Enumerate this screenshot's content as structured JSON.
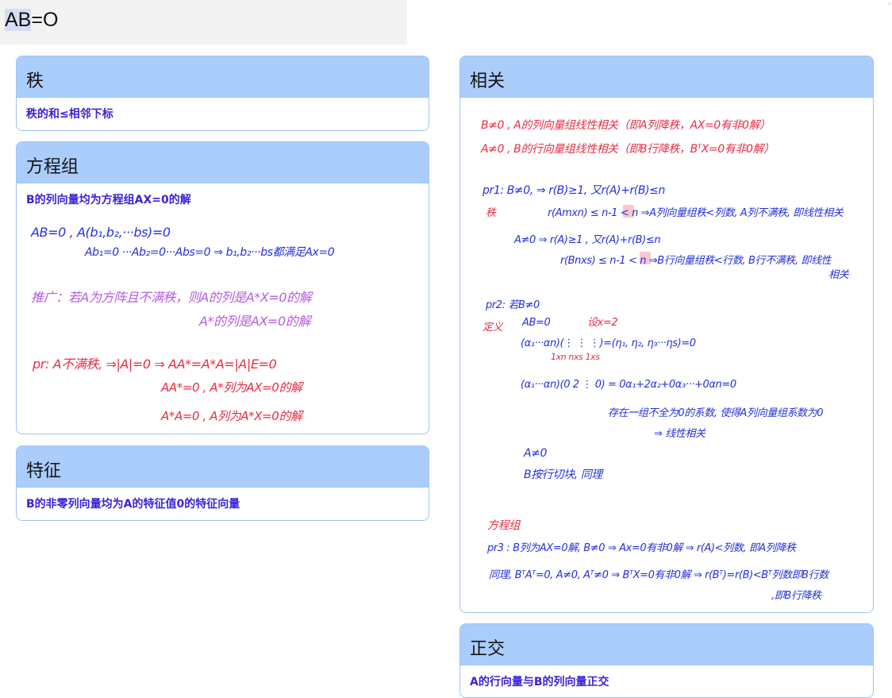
{
  "title": {
    "highlight": "AB",
    "rest": "=O"
  },
  "corner": "◦",
  "cards": {
    "rank": {
      "header": "秩",
      "subtitle": "秩的和≤相邻下标"
    },
    "equations": {
      "header": "方程组",
      "subtitle": "B的列向量均为方程组AX=0的解"
    },
    "eigen": {
      "header": "特征",
      "subtitle": "B的非零列向量均为A的特征值0的特征向量"
    },
    "related": {
      "header": "相关"
    },
    "ortho": {
      "header": "正交",
      "subtitle": "A的行向量与B的列向量正交"
    }
  },
  "notes_equations": {
    "l1": "AB=0 , A(b₁,b₂,···bs)=0",
    "l2": "Ab₁=0 ···Ab₂=0···Abs=0 ⇒ b₁,b₂···bs都满足Ax=0",
    "l3": "推广：若A为方阵且不满秩，则A的列是A*X=0的解",
    "l4": "A*的列是AX=0的解",
    "l5": "pr: A不满秩, ⇒|A|=0 ⇒ AA*=A*A=|A|E=0",
    "l6": "AA*=0 , A*列为AX=0的解",
    "l7": "A*A=0 , A列为A*X=0的解"
  },
  "notes_related": {
    "r1": "B≠0 , A的列向量组线性相关（即A列降秩，AX=0有非0解）",
    "r2": "A≠0 , B的行向量组线性相关（即B行降秩，BᵀX=0有非0解）",
    "r3": "pr1:  B≠0, ⇒ r(B)≥1, 又r(A)+r(B)≤n",
    "r4": "秩",
    "r5": "r(Amxn) ≤ n-1 < n ⇒A列向量组秩<列数, A列不满秩, 即线性相关",
    "r6": "A≠0 ⇒ r(A)≥1 , 又r(A)+r(B)≤n",
    "r7": "r(Bnxs) ≤ n-1 < n  ⇒B行向量组秩<行数, B行不满秩, 即线性",
    "r8": "相关",
    "r9": "pr2:  若B≠0",
    "r10": "定义",
    "r11": "AB=0",
    "r12": "设x=2",
    "r13": "(α₁···αn)(⋮ ⋮ ⋮)=(η₁, η₂, η₃···ηs)=0",
    "r14": "1xn nxs        1xs",
    "r15": "(α₁···αn)(0 2 ⋮ 0) = 0α₁+2α₂+0α₃···+0αn=0",
    "r16": "存在一组不全为0的系数, 使得A列向量组系数为0",
    "r17": "⇒ 线性相关",
    "r18": "A≠0",
    "r19": "B按行切块, 同理",
    "r20": "方程组",
    "r21": "pr3 : B列为AX=0解, B≠0 ⇒ Ax=0有非0解 ⇒ r(A)<列数, 即A列降秩",
    "r22": "同理, BᵀAᵀ=0, A≠0, Aᵀ≠0 ⇒ BᵀX=0有非0解 ⇒ r(Bᵀ)=r(B)<Bᵀ列数即B行数",
    "r23": ",即B行降秩"
  }
}
